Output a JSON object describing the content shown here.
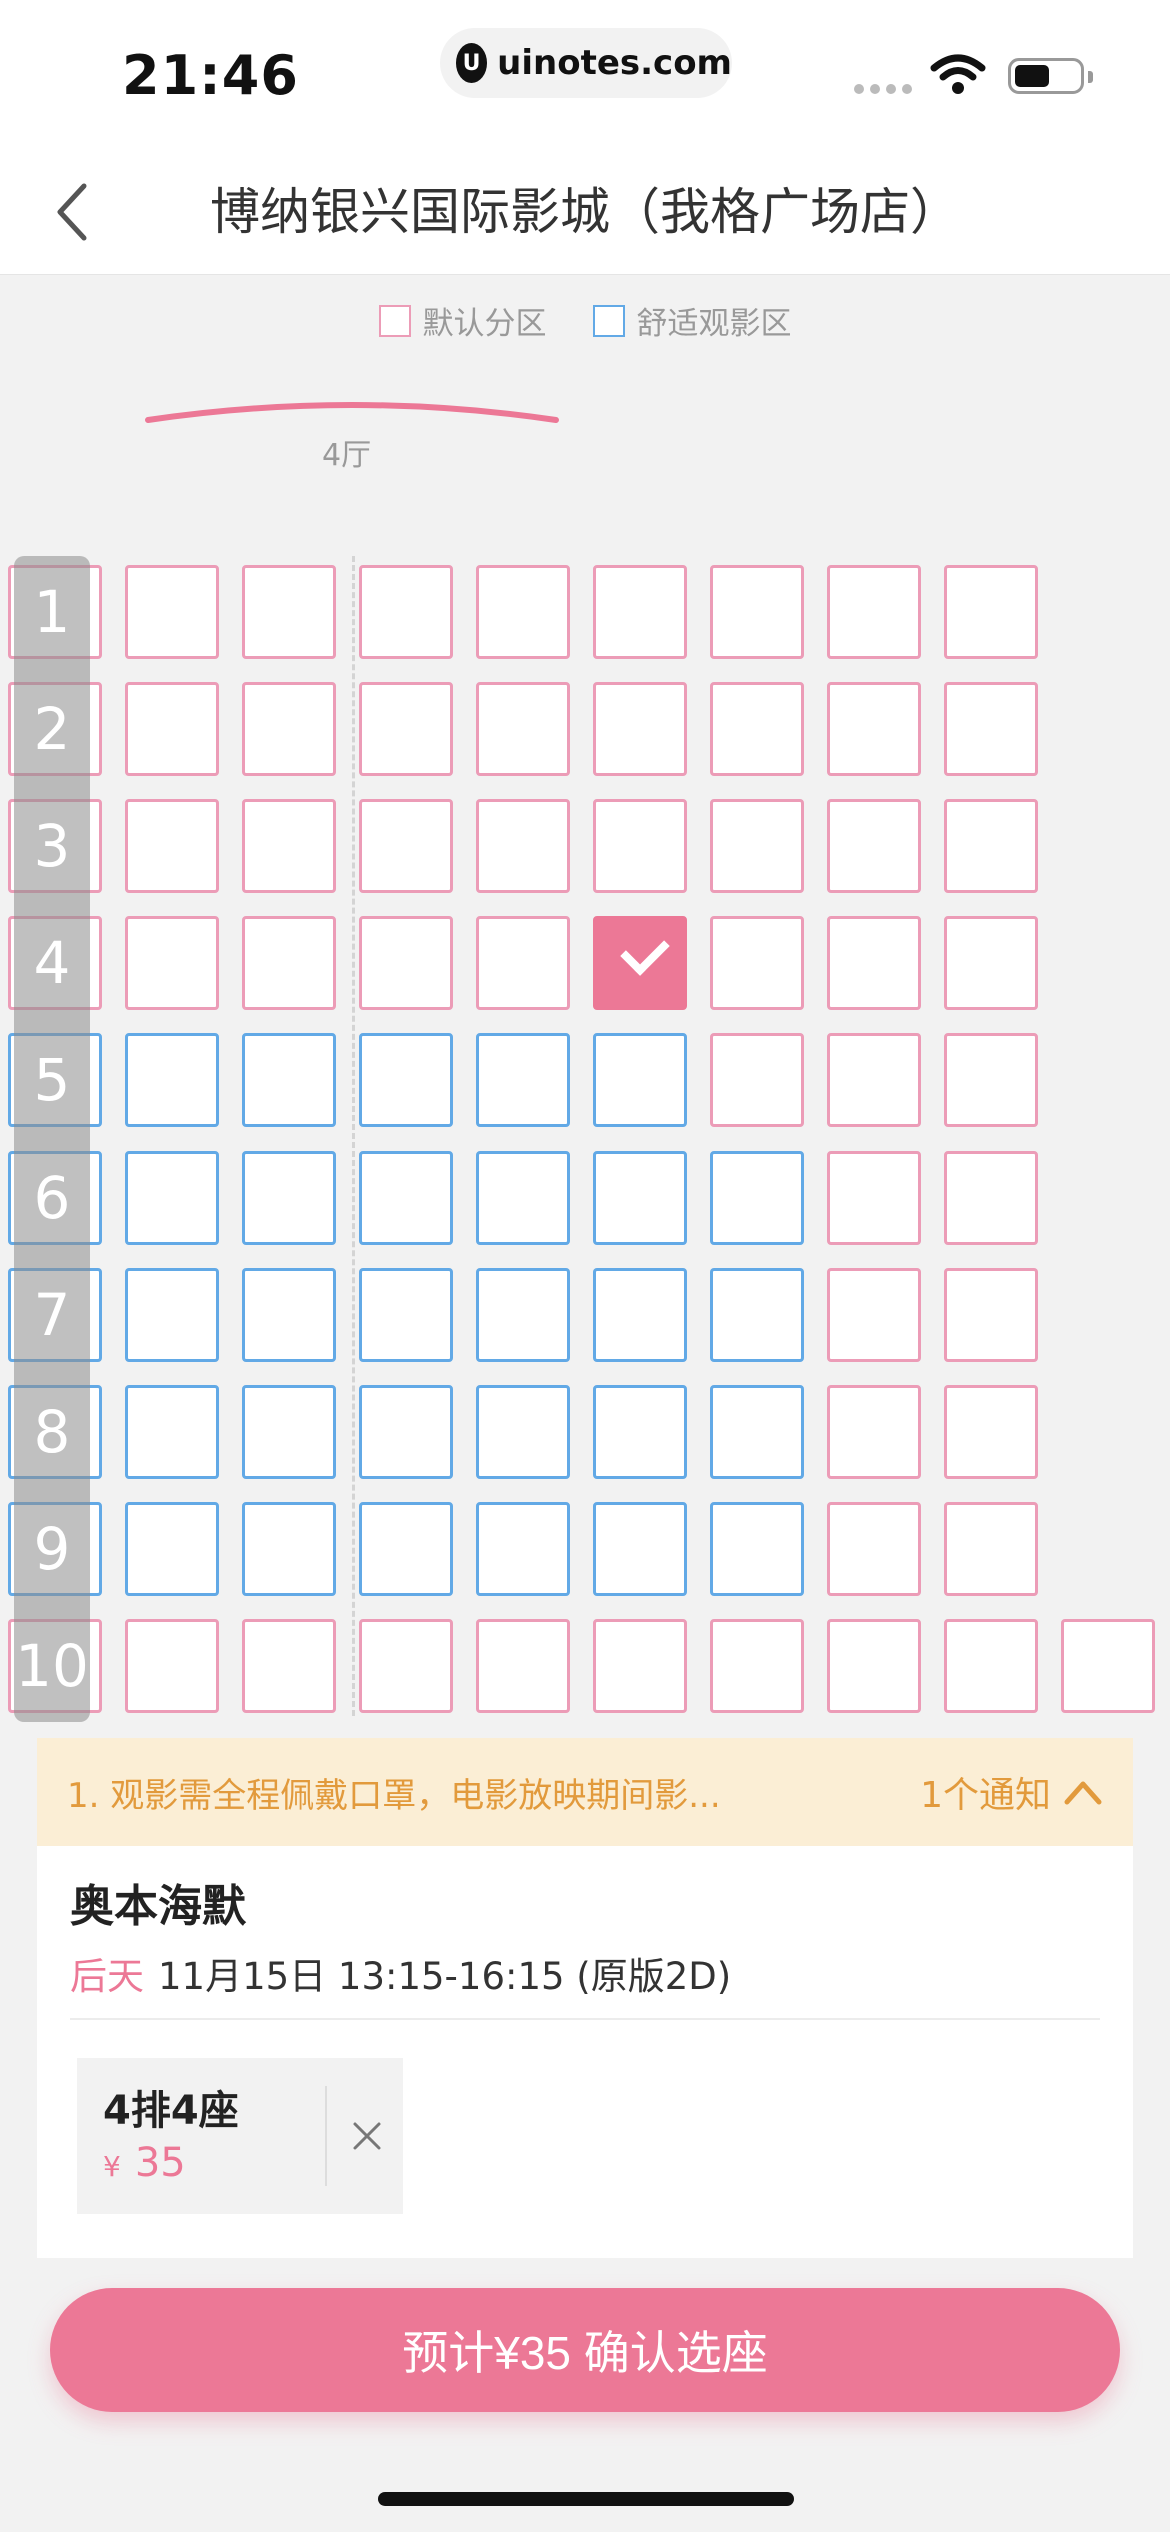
{
  "status_bar": {
    "time": "21:46",
    "url_logo": "U",
    "url": "uinotes.com"
  },
  "nav": {
    "title": "博纳银兴国际影城（我格广场店）",
    "back_icon": "chevron-left-icon"
  },
  "legend": {
    "default_zone": "默认分区",
    "comfort_zone": "舒适观影区",
    "default_color": "#ec9cb7",
    "comfort_color": "#62a9e6"
  },
  "hall": {
    "name": "4厅"
  },
  "rows": [
    {
      "num": "1",
      "seats": [
        "pink",
        "pink",
        "pink",
        "pink",
        "pink",
        "pink",
        "pink",
        "pink",
        "pink"
      ]
    },
    {
      "num": "2",
      "seats": [
        "pink",
        "pink",
        "pink",
        "pink",
        "pink",
        "pink",
        "pink",
        "pink",
        "pink"
      ]
    },
    {
      "num": "3",
      "seats": [
        "pink",
        "pink",
        "pink",
        "pink",
        "pink",
        "pink",
        "pink",
        "pink",
        "pink"
      ]
    },
    {
      "num": "4",
      "seats": [
        "pink",
        "pink",
        "pink",
        "pink",
        "pink",
        "selected",
        "pink",
        "pink",
        "pink"
      ]
    },
    {
      "num": "5",
      "seats": [
        "blue",
        "blue",
        "blue",
        "blue",
        "blue",
        "blue",
        "pink",
        "pink",
        "pink"
      ]
    },
    {
      "num": "6",
      "seats": [
        "blue",
        "blue",
        "blue",
        "blue",
        "blue",
        "blue",
        "blue",
        "pink",
        "pink"
      ]
    },
    {
      "num": "7",
      "seats": [
        "blue",
        "blue",
        "blue",
        "blue",
        "blue",
        "blue",
        "blue",
        "pink",
        "pink"
      ]
    },
    {
      "num": "8",
      "seats": [
        "blue",
        "blue",
        "blue",
        "blue",
        "blue",
        "blue",
        "blue",
        "pink",
        "pink"
      ]
    },
    {
      "num": "9",
      "seats": [
        "blue",
        "blue",
        "blue",
        "blue",
        "blue",
        "blue",
        "blue",
        "pink",
        "pink"
      ]
    },
    {
      "num": "10",
      "seats": [
        "pink",
        "pink",
        "pink",
        "pink",
        "pink",
        "pink",
        "pink",
        "pink",
        "pink",
        "pink"
      ]
    }
  ],
  "notice": {
    "text": "1. 观影需全程佩戴口罩，电影放映期间影...",
    "count": "1个通知",
    "icon": "chevron-up-icon"
  },
  "movie": {
    "title": "奥本海默",
    "day": "后天",
    "datetime": "11月15日 13:15-16:15 (原版2D)"
  },
  "ticket": {
    "seat": "4排4座",
    "currency": "¥",
    "price": "35",
    "remove_icon": "close-icon"
  },
  "confirm": {
    "label": "预计¥35 确认选座"
  },
  "colors": {
    "accent": "#ec7896",
    "notice_bg": "#fbeed5",
    "notice_text": "#e29a3c"
  }
}
